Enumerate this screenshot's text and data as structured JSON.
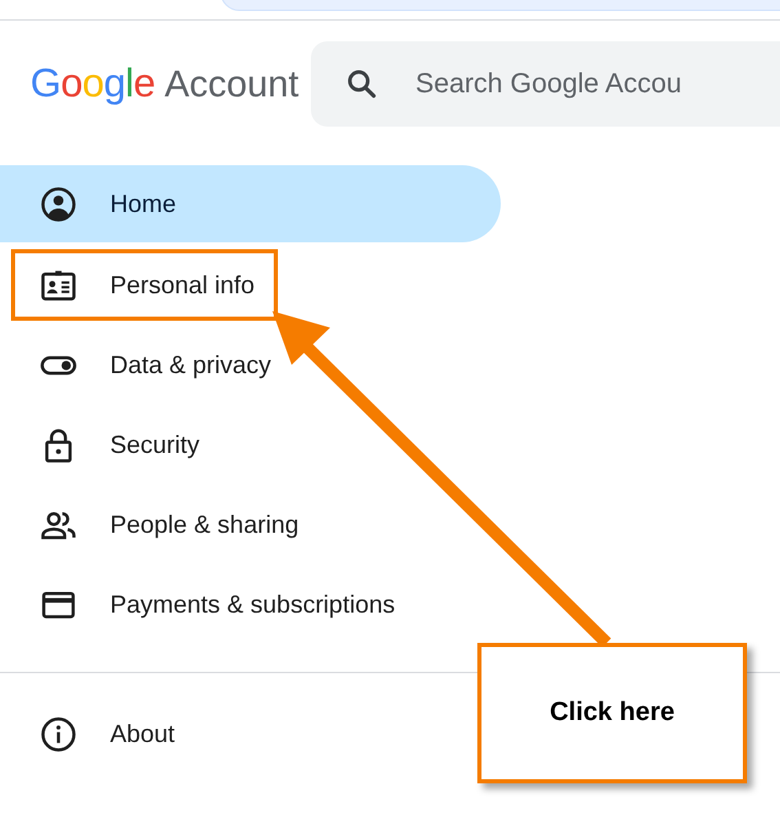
{
  "header": {
    "logo": [
      {
        "text": "G",
        "color": "#4285f4"
      },
      {
        "text": "o",
        "color": "#ea4335"
      },
      {
        "text": "o",
        "color": "#fbbc05"
      },
      {
        "text": "g",
        "color": "#4285f4"
      },
      {
        "text": "l",
        "color": "#34a853"
      },
      {
        "text": "e",
        "color": "#ea4335"
      }
    ],
    "product": "Account",
    "search": {
      "placeholder": "Search Google Accou"
    }
  },
  "nav": {
    "items": [
      {
        "kind": "home",
        "label": "Home",
        "selected": true,
        "highlighted": false
      },
      {
        "kind": "person-card",
        "label": "Personal info",
        "selected": false,
        "highlighted": true
      },
      {
        "kind": "toggle",
        "label": "Data & privacy",
        "selected": false,
        "highlighted": false
      },
      {
        "kind": "lock",
        "label": "Security",
        "selected": false,
        "highlighted": false
      },
      {
        "kind": "people",
        "label": "People & sharing",
        "selected": false,
        "highlighted": false
      },
      {
        "kind": "card",
        "label": "Payments & subscriptions",
        "selected": false,
        "highlighted": false
      }
    ],
    "footer_items": [
      {
        "kind": "info",
        "label": "About",
        "selected": false,
        "highlighted": false
      }
    ]
  },
  "callout": {
    "text": "Click here"
  }
}
